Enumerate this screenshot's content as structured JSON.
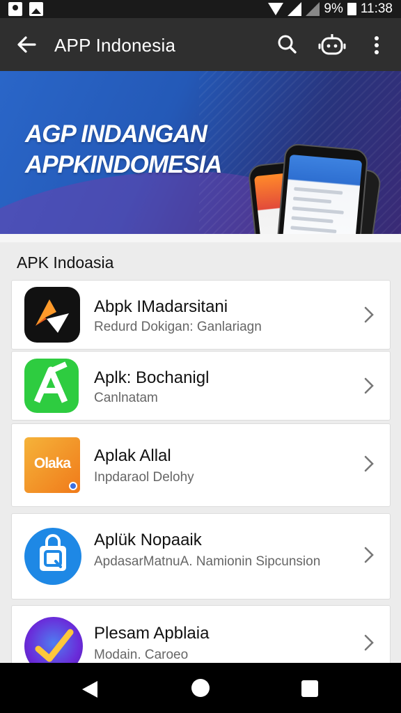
{
  "status_bar": {
    "battery": "9%",
    "time": "11:38"
  },
  "app_bar": {
    "title": "APP Indonesia",
    "icons": [
      "back-arrow-icon",
      "search-icon",
      "bot-icon",
      "more-vert-icon"
    ]
  },
  "banner": {
    "line1": "AGP INDANGAN",
    "line2": "APPKINDOMESIA"
  },
  "section": {
    "title": "APK Indoasia"
  },
  "apps": [
    {
      "title": "Abpk IMadarsitani",
      "subtitle": "Redurd Dokigan: Ganlariagn",
      "icon": "orange-chevron-app-icon",
      "icon_bg": "#111111"
    },
    {
      "title": "Aplk: Bochanigl",
      "subtitle": "Canlnatam",
      "icon": "green-a-app-icon",
      "icon_bg": "#2ecc40"
    },
    {
      "title": "Aplak Allal",
      "subtitle": "Inpdaraol Delohy",
      "icon": "orange-olaka-app-icon",
      "icon_text": "Olaka",
      "icon_bg": "#f59a1e"
    },
    {
      "title": "Aplük Nopaaik",
      "subtitle": "ApdasarMatnuA. Namionin Sipcunsion",
      "icon": "blue-bag-app-icon",
      "icon_bg": "#1e88e5"
    },
    {
      "title": "Plesam Apblaia",
      "subtitle": "Modain. Caroeo",
      "icon": "purple-check-app-icon",
      "icon_bg": "#6a2bd9"
    }
  ],
  "nav_bar": {
    "icons": [
      "nav-back-icon",
      "nav-home-icon",
      "nav-recent-icon"
    ]
  }
}
